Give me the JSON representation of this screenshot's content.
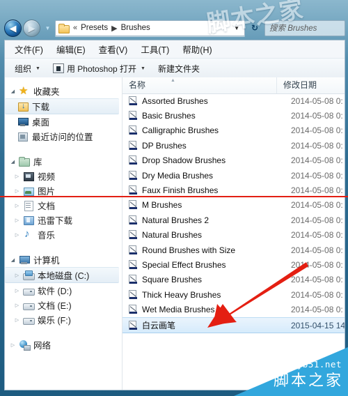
{
  "window": {
    "search_placeholder": "搜索 Brushes",
    "path_crumbs": [
      "Presets",
      "Brushes"
    ],
    "overflow_chevron": "«",
    "crumb_separator": "▶",
    "back_glyph": "◀",
    "forward_glyph": "▶",
    "recent_chevron": "▼",
    "path_dropdown_glyph": "▼",
    "refresh_glyph": "↻"
  },
  "menubar": {
    "items": [
      {
        "label": "文件(F)",
        "name": "menu-file"
      },
      {
        "label": "编辑(E)",
        "name": "menu-edit"
      },
      {
        "label": "查看(V)",
        "name": "menu-view"
      },
      {
        "label": "工具(T)",
        "name": "menu-tools"
      },
      {
        "label": "帮助(H)",
        "name": "menu-help"
      }
    ]
  },
  "toolbar": {
    "organize_label": "组织",
    "organize_caret": "▼",
    "open_with_label": "用 Photoshop 打开",
    "open_with_caret": "▼",
    "new_folder_label": "新建文件夹"
  },
  "navpane": {
    "favorites": {
      "label": "收藏夹",
      "twisty": "◢",
      "items": [
        {
          "label": "下载",
          "icon": "download-icon",
          "selected": true
        },
        {
          "label": "桌面",
          "icon": "desktop-icon",
          "selected": false
        },
        {
          "label": "最近访问的位置",
          "icon": "recent-places-icon",
          "selected": false
        }
      ]
    },
    "libraries": {
      "label": "库",
      "twisty": "◢",
      "items": [
        {
          "label": "视频",
          "icon": "video-icon",
          "twisty": "▷"
        },
        {
          "label": "图片",
          "icon": "picture-icon",
          "twisty": "▷"
        },
        {
          "label": "文档",
          "icon": "document-icon",
          "twisty": "▷"
        },
        {
          "label": "迅雷下载",
          "icon": "thunder-download-icon",
          "twisty": "▷"
        },
        {
          "label": "音乐",
          "icon": "music-icon",
          "twisty": "▷"
        }
      ]
    },
    "computer": {
      "label": "计算机",
      "twisty": "◢",
      "items": [
        {
          "label": "本地磁盘 (C:)",
          "icon": "system-drive-icon",
          "twisty": "▷",
          "selected": true
        },
        {
          "label": "软件 (D:)",
          "icon": "drive-icon",
          "twisty": "▷",
          "selected": false
        },
        {
          "label": "文档 (E:)",
          "icon": "drive-icon",
          "twisty": "▷",
          "selected": false
        },
        {
          "label": "娱乐 (F:)",
          "icon": "drive-icon",
          "twisty": "▷",
          "selected": false
        }
      ]
    },
    "network": {
      "label": "网络",
      "icon": "network-icon",
      "twisty": "▷"
    }
  },
  "filelist": {
    "columns": {
      "name": "名称",
      "date": "修改日期"
    },
    "sort_indicator": "▲",
    "rows": [
      {
        "name": "Assorted Brushes",
        "date": "2014-05-08 0:",
        "selected": false
      },
      {
        "name": "Basic Brushes",
        "date": "2014-05-08 0:",
        "selected": false
      },
      {
        "name": "Calligraphic Brushes",
        "date": "2014-05-08 0:",
        "selected": false
      },
      {
        "name": "DP Brushes",
        "date": "2014-05-08 0:",
        "selected": false
      },
      {
        "name": "Drop Shadow Brushes",
        "date": "2014-05-08 0:",
        "selected": false
      },
      {
        "name": "Dry Media Brushes",
        "date": "2014-05-08 0:",
        "selected": false
      },
      {
        "name": "Faux Finish Brushes",
        "date": "2014-05-08 0:",
        "selected": false
      },
      {
        "name": "M Brushes",
        "date": "2014-05-08 0:",
        "selected": false
      },
      {
        "name": "Natural Brushes 2",
        "date": "2014-05-08 0:",
        "selected": false
      },
      {
        "name": "Natural Brushes",
        "date": "2014-05-08 0:",
        "selected": false
      },
      {
        "name": "Round Brushes with Size",
        "date": "2014-05-08 0:",
        "selected": false
      },
      {
        "name": "Special Effect Brushes",
        "date": "2014-05-08 0:",
        "selected": false
      },
      {
        "name": "Square Brushes",
        "date": "2014-05-08 0:",
        "selected": false
      },
      {
        "name": "Thick Heavy Brushes",
        "date": "2014-05-08 0:",
        "selected": false
      },
      {
        "name": "Wet Media Brushes",
        "date": "2014-05-08 0:",
        "selected": false
      },
      {
        "name": "白云画笔",
        "date": "2015-04-15 14",
        "selected": true
      }
    ]
  },
  "watermark": {
    "top_text": "脚本之家",
    "corner_url": "jb51.net",
    "corner_cn": "脚本之家"
  },
  "colors": {
    "accent": "#32a7dd",
    "annotation_red": "#e21f13",
    "selection_blue": "#d6ebfb"
  }
}
